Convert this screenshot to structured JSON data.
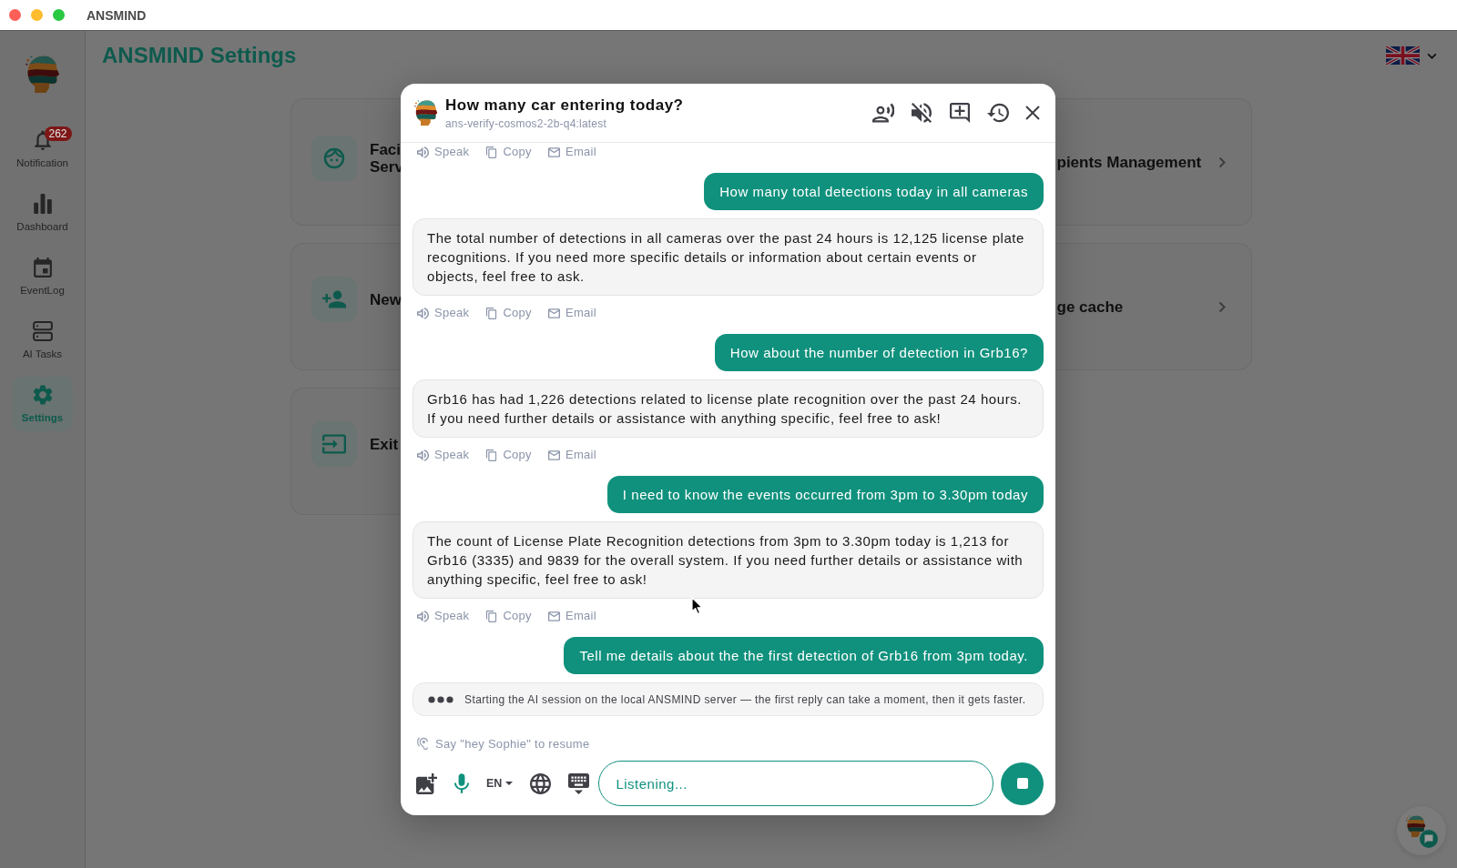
{
  "window": {
    "title": "ANSMIND"
  },
  "sidebar": {
    "items": [
      {
        "label": "Notification",
        "badge": "262",
        "selected": false
      },
      {
        "label": "Dashboard",
        "selected": false
      },
      {
        "label": "EventLog",
        "selected": false
      },
      {
        "label": "AI Tasks",
        "selected": false
      },
      {
        "label": "Settings",
        "selected": true
      }
    ]
  },
  "page": {
    "title": "ANSMIND Settings",
    "cards": [
      {
        "lines": [
          "Faci",
          "Serv"
        ]
      },
      {
        "lines": [
          "pients Management"
        ]
      },
      {
        "lines": [
          "New"
        ]
      },
      {
        "lines": [
          "ge cache"
        ]
      },
      {
        "lines": [
          "Exit"
        ]
      }
    ]
  },
  "chat": {
    "title": "How many car entering today?",
    "model": "ans-verify-cosmos2-2b-q4:latest",
    "messages": [
      {
        "kind": "assistant",
        "actions": [
          "Speak",
          "Copy",
          "Email"
        ]
      },
      {
        "kind": "user",
        "text": "How many total detections today in all cameras"
      },
      {
        "kind": "assistant",
        "text": "The total number of detections in all cameras over the past 24 hours is 12,125 license plate recognitions. If you need more specific details or information about certain events or objects, feel free to ask.",
        "actions": [
          "Speak",
          "Copy",
          "Email"
        ]
      },
      {
        "kind": "user",
        "text": "How about the number of detection in Grb16?"
      },
      {
        "kind": "assistant",
        "text": "Grb16 has had 1,226 detections related to license plate recognition over the past 24 hours. If you need further details or assistance with anything specific, feel free to ask!",
        "actions": [
          "Speak",
          "Copy",
          "Email"
        ]
      },
      {
        "kind": "user",
        "text": "I need to know the events occurred from 3pm to 3.30pm today"
      },
      {
        "kind": "assistant",
        "text": "The count of License Plate Recognition detections from 3pm to 3.30pm today is 1,213 for Grb16 (3335) and 9839 for the overall system. If you need further details or assistance with anything specific, feel free to ask!",
        "actions": [
          "Speak",
          "Copy",
          "Email"
        ]
      },
      {
        "kind": "user",
        "text": "Tell me details about the the first detection of Grb16 from 3pm today."
      },
      {
        "kind": "status",
        "text": "Starting the AI session on the local ANSMIND server — the first reply can take a moment, then it gets faster."
      }
    ],
    "hint": "Say \"hey Sophie\" to resume",
    "language": "EN",
    "placeholder": "Listening..."
  }
}
